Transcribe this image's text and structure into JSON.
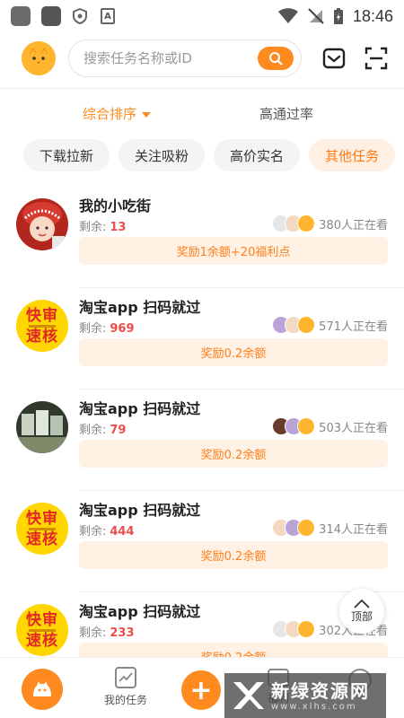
{
  "status_bar": {
    "time": "18:46"
  },
  "search": {
    "placeholder": "搜索任务名称或ID"
  },
  "sort_tabs": [
    {
      "label": "综合排序",
      "active": true
    },
    {
      "label": "高通过率",
      "active": false
    }
  ],
  "categories": [
    {
      "label": "下载拉新",
      "active": false
    },
    {
      "label": "关注吸粉",
      "active": false
    },
    {
      "label": "高价实名",
      "active": false
    },
    {
      "label": "其他任务",
      "active": true
    }
  ],
  "tasks": [
    {
      "title": "我的小吃街",
      "remain_label": "剩余:",
      "remain": "13",
      "viewers": "380人正在看",
      "reward": "奖励1余额+20福利点"
    },
    {
      "title": "淘宝app 扫码就过",
      "remain_label": "剩余:",
      "remain": "969",
      "viewers": "571人正在看",
      "reward": "奖励0.2余额"
    },
    {
      "title": "淘宝app 扫码就过",
      "remain_label": "剩余:",
      "remain": "79",
      "viewers": "503人正在看",
      "reward": "奖励0.2余额"
    },
    {
      "title": "淘宝app 扫码就过",
      "remain_label": "剩余:",
      "remain": "444",
      "viewers": "314人正在看",
      "reward": "奖励0.2余额"
    },
    {
      "title": "淘宝app 扫码就过",
      "remain_label": "剩余:",
      "remain": "233",
      "viewers": "302人正在看",
      "reward": "奖励0.2余额"
    }
  ],
  "avatar_text": {
    "line1": "快审",
    "line2": "速核"
  },
  "top_button": {
    "label": "顶部"
  },
  "bottom_nav": {
    "tasks": "我的任务",
    "welfare": "福利",
    "add": "+"
  },
  "watermark": {
    "name": "新绿资源网",
    "url": "www.xlhs.com"
  },
  "colors": {
    "accent": "#ff8a1f",
    "reward_bg": "#fff1e4",
    "remain_num": "#ee4d4d"
  }
}
